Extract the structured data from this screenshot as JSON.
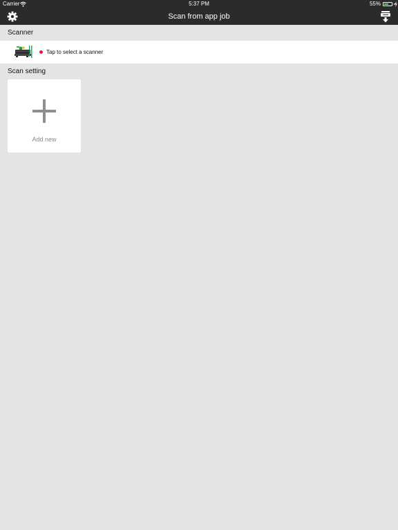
{
  "status_bar": {
    "carrier": "Carrier",
    "time": "5:37 PM",
    "battery": "55%"
  },
  "nav": {
    "title": "Scan from app job",
    "left_icon": "gear-icon",
    "right_icon": "scanner-download-icon"
  },
  "scanner_section": {
    "header": "Scanner",
    "row_text": "Tap to select a scanner",
    "status_color": "#e5173f"
  },
  "scan_setting_section": {
    "header": "Scan setting",
    "add_label": "Add new"
  },
  "colors": {
    "bar": "#2b2b2b",
    "background": "#e4e4e4"
  }
}
